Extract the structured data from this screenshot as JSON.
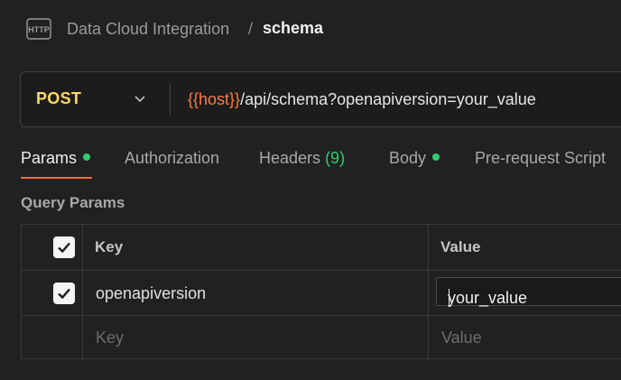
{
  "header": {
    "icon": "http-icon",
    "collection": "Data Cloud Integration",
    "separator": "/",
    "request_name": "schema"
  },
  "url_bar": {
    "method": "POST",
    "url_variable": "{{host}}",
    "url_path": "/api/schema?openapiversion=your_value"
  },
  "tabs": [
    {
      "label": "Params",
      "indicator": "dot",
      "active": true
    },
    {
      "label": "Authorization"
    },
    {
      "label": "Headers",
      "count": "(9)"
    },
    {
      "label": "Body",
      "indicator": "dot"
    },
    {
      "label": "Pre-request Script"
    }
  ],
  "query_params": {
    "title": "Query Params",
    "columns": {
      "key": "Key",
      "value": "Value"
    },
    "rows": [
      {
        "checked": true,
        "key": "openapiversion",
        "value": "your_value"
      }
    ],
    "empty_row": {
      "key_placeholder": "Key",
      "value_placeholder": "Value"
    }
  },
  "colors": {
    "accent": "#ff6c37",
    "method_post": "#ffd866",
    "variable": "#ff7a45",
    "status_dot": "#2ecc71"
  }
}
